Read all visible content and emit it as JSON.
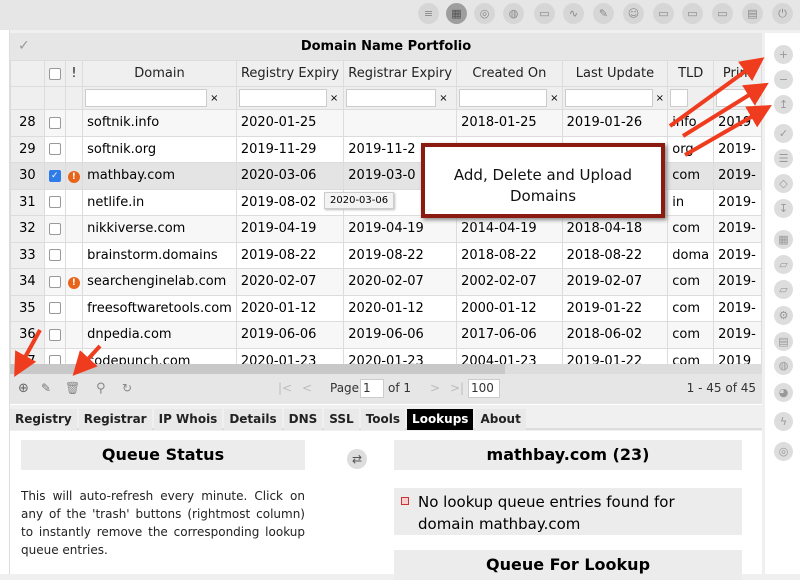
{
  "topbar": {
    "icons": [
      "menu-icon",
      "dashboard-icon",
      "globe-search-icon",
      "globe-icon",
      "monitor-network-icon",
      "chart-line-icon",
      "pencil-icon",
      "user-network-icon",
      "monitor-1-icon",
      "monitor-2-icon",
      "monitor-3-icon",
      "spreadsheet-icon",
      "power-icon"
    ],
    "active": "dashboard-icon"
  },
  "grid": {
    "title": "Domain Name Portfolio",
    "columns": [
      "",
      "",
      "!",
      "Domain",
      "Registry Expiry",
      "Registrar Expiry",
      "Created On",
      "Last Update",
      "TLD",
      "Prim"
    ],
    "rows": [
      {
        "n": "28",
        "checked": false,
        "alert": false,
        "domain": "softnik.info",
        "reg": "2020-01-25",
        "rar": "",
        "created": "2018-01-25",
        "updated": "2019-01-26",
        "tld": "info",
        "prim": "2019"
      },
      {
        "n": "29",
        "checked": false,
        "alert": false,
        "domain": "softnik.org",
        "reg": "2019-11-29",
        "rar": "2019-11-2",
        "created": "",
        "updated": "",
        "tld": "org",
        "prim": "2019-"
      },
      {
        "n": "30",
        "checked": true,
        "alert": true,
        "domain": "mathbay.com",
        "reg": "2020-03-06",
        "rar": "2019-03-0",
        "created": "",
        "updated": "",
        "tld": "com",
        "prim": "2019-"
      },
      {
        "n": "31",
        "checked": false,
        "alert": false,
        "domain": "netlife.in",
        "reg": "2019-08-02",
        "rar": "",
        "created": "",
        "updated": "",
        "tld": "in",
        "prim": "2019-"
      },
      {
        "n": "32",
        "checked": false,
        "alert": false,
        "domain": "nikkiverse.com",
        "reg": "2019-04-19",
        "rar": "2019-04-19",
        "created": "2014-04-19",
        "updated": "2018-04-18",
        "tld": "com",
        "prim": "2019-"
      },
      {
        "n": "33",
        "checked": false,
        "alert": false,
        "domain": "brainstorm.domains",
        "reg": "2019-08-22",
        "rar": "2019-08-22",
        "created": "2018-08-22",
        "updated": "2018-08-22",
        "tld": "doma",
        "prim": "2019-"
      },
      {
        "n": "34",
        "checked": false,
        "alert": true,
        "domain": "searchenginelab.com",
        "reg": "2020-02-07",
        "rar": "2020-02-07",
        "created": "2002-02-07",
        "updated": "2019-02-07",
        "tld": "com",
        "prim": "2019-"
      },
      {
        "n": "35",
        "checked": false,
        "alert": false,
        "domain": "freesoftwaretools.com",
        "reg": "2020-01-12",
        "rar": "2020-01-12",
        "created": "2000-01-12",
        "updated": "2019-01-22",
        "tld": "com",
        "prim": "2019-"
      },
      {
        "n": "36",
        "checked": false,
        "alert": false,
        "domain": "dnpedia.com",
        "reg": "2019-06-06",
        "rar": "2019-06-06",
        "created": "2017-06-06",
        "updated": "2018-06-02",
        "tld": "com",
        "prim": "2019-"
      },
      {
        "n": "37",
        "checked": false,
        "alert": false,
        "domain": "codepunch.com",
        "reg": "2020-01-23",
        "rar": "2020-01-23",
        "created": "2004-01-23",
        "updated": "2019-01-22",
        "tld": "com",
        "prim": "2019"
      }
    ],
    "tooltip": "2020-03-06"
  },
  "toolbar": {
    "page_label": "Page",
    "page": "1",
    "of_label": "of 1",
    "page_size": "100",
    "range": "1 - 45 of 45"
  },
  "tabs": [
    "Registry",
    "Registrar",
    "IP Whois",
    "Details",
    "DNS",
    "SSL",
    "Tools",
    "Lookups",
    "About"
  ],
  "active_tab": "Lookups",
  "lookups": {
    "queue_status_title": "Queue Status",
    "queue_status_text": "This will auto-refresh every minute. Click on any of the 'trash' buttons (rightmost column) to instantly remove the corresponding lookup queue entries.",
    "domain_title": "mathbay.com (23)",
    "no_entries": "No lookup queue entries found for domain mathbay.com",
    "queue_for_lookup_title": "Queue For Lookup"
  },
  "callout": "Add, Delete and Upload Domains",
  "right_sidebar": {
    "icons": [
      "add-icon",
      "remove-icon",
      "upload-icon",
      "check-icon",
      "list-icon",
      "tag-icon",
      "download-icon",
      "table-add-icon",
      "folder-check-icon",
      "folder-edit-icon",
      "gear-icon",
      "table-edit-icon",
      "globe-settings-icon",
      "palette-icon",
      "lightning-icon",
      "lifebuoy-icon"
    ]
  },
  "colors": {
    "accent_red": "#f03c1e",
    "callout_border": "#8b1a10",
    "checkbox_blue": "#2f7bea",
    "alert_orange": "#e8641b"
  }
}
